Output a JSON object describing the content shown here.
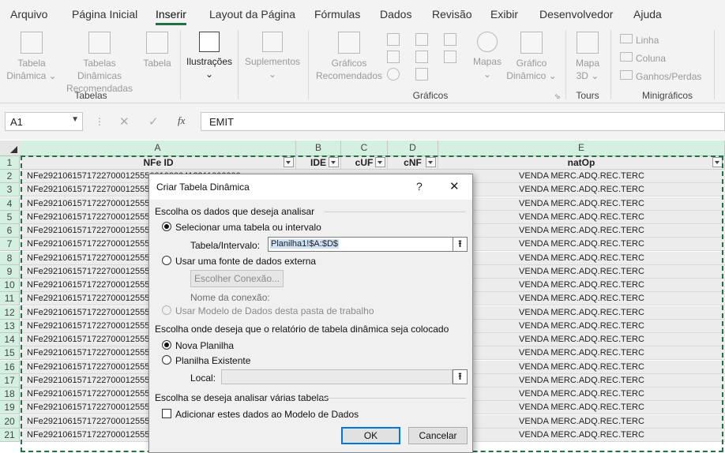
{
  "ribbon_tabs": [
    "Arquivo",
    "Página Inicial",
    "Inserir",
    "Layout da Página",
    "Fórmulas",
    "Dados",
    "Revisão",
    "Exibir",
    "Desenvolvedor",
    "Ajuda"
  ],
  "ribbon": {
    "tabela_dinamica": [
      "Tabela",
      "Dinâmica ⌄"
    ],
    "tabelas_recomendadas": [
      "Tabelas Dinâmicas",
      "Recomendadas"
    ],
    "tabela": "Tabela",
    "ilustracoes": "Ilustrações",
    "suplementos": "Suplementos",
    "graficos_recomendados": [
      "Gráficos",
      "Recomendados"
    ],
    "mapas": "Mapas",
    "grafico_dinamico": [
      "Gráfico",
      "Dinâmico ⌄"
    ],
    "mapa3d": [
      "Mapa",
      "3D ⌄"
    ],
    "linha": "Linha",
    "coluna": "Coluna",
    "ganhos_perdas": "Ganhos/Perdas",
    "groups": {
      "tabelas": "Tabelas",
      "graficos": "Gráficos",
      "tours": "Tours",
      "minigraficos": "Minigráficos"
    }
  },
  "formula_bar": {
    "name_box": "A1",
    "fx": "fx",
    "content": "EMIT"
  },
  "columns": [
    "A",
    "B",
    "C",
    "D",
    "E"
  ],
  "headers": {
    "a": "NFe ID",
    "b": "IDE",
    "c": "cUF",
    "d": "cNF",
    "e": "natOp"
  },
  "rows": [
    "2",
    "3",
    "4",
    "5",
    "6",
    "7",
    "8",
    "9",
    "10",
    "11",
    "12",
    "13",
    "14",
    "15",
    "16",
    "17",
    "18",
    "19",
    "20",
    "21"
  ],
  "cell_a_value": "NFe29210615717227000125550010000412311000000",
  "cell_e_value": "VENDA MERC.ADQ.REC.TERC",
  "dialog": {
    "title": "Criar Tabela Dinâmica",
    "help": "?",
    "close": "✕",
    "section1": "Escolha os dados que deseja analisar",
    "opt_select_table": "Selecionar uma tabela ou intervalo",
    "table_range_label": "Tabela/Intervalo:",
    "table_range_value": "Planilha1!$A:$D$",
    "opt_external": "Usar uma fonte de dados externa",
    "choose_connection": "Escolher Conexão...",
    "connection_name_label": "Nome da conexão:",
    "opt_data_model": "Usar Modelo de Dados desta pasta de trabalho",
    "section2": "Escolha onde deseja que o relatório de tabela dinâmica seja colocado",
    "opt_new_sheet": "Nova Planilha",
    "opt_existing_sheet": "Planilha Existente",
    "local_label": "Local:",
    "section3": "Escolha se deseja analisar várias tabelas",
    "add_to_model": "Adicionar estes dados ao Modelo de Dados",
    "ok": "OK",
    "cancel": "Cancelar"
  }
}
